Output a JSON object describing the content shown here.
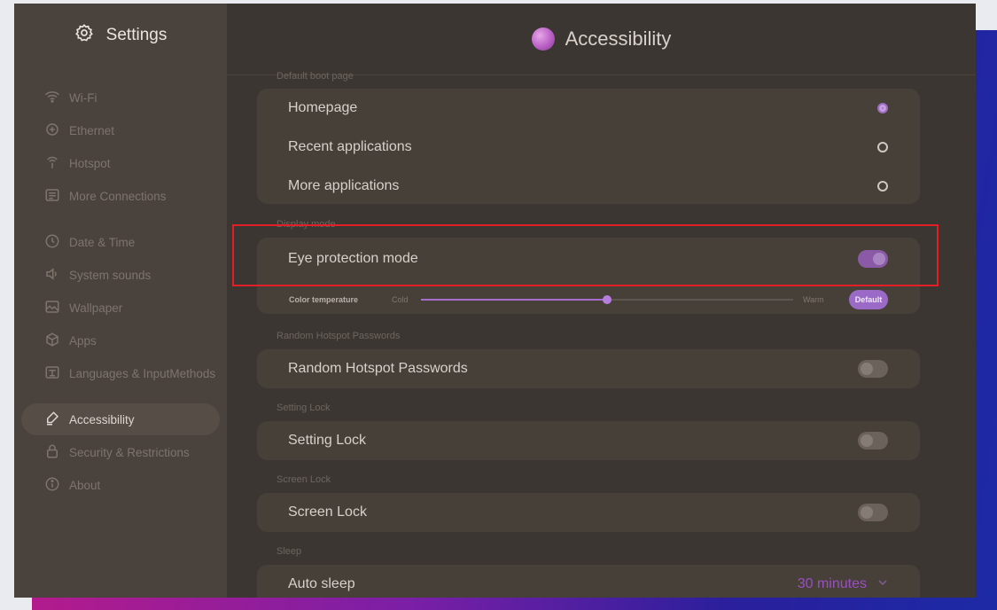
{
  "sidebar": {
    "title": "Settings",
    "items": [
      {
        "label": "Wi-Fi",
        "icon": "wifi-icon"
      },
      {
        "label": "Ethernet",
        "icon": "ethernet-icon"
      },
      {
        "label": "Hotspot",
        "icon": "hotspot-icon"
      },
      {
        "label": "More Connections",
        "icon": "connections-icon"
      },
      {
        "label": "Date & Time",
        "icon": "clock-icon"
      },
      {
        "label": "System sounds",
        "icon": "speaker-icon"
      },
      {
        "label": "Wallpaper",
        "icon": "wallpaper-icon"
      },
      {
        "label": "Apps",
        "icon": "apps-icon"
      },
      {
        "label": "Languages & InputMethods",
        "icon": "language-icon"
      },
      {
        "label": "Accessibility",
        "icon": "accessibility-icon"
      },
      {
        "label": "Security & Restrictions",
        "icon": "lock-icon"
      },
      {
        "label": "About",
        "icon": "info-icon"
      }
    ],
    "active_item": "Accessibility"
  },
  "main": {
    "title": "Accessibility",
    "sections": {
      "default_boot_page": {
        "label": "Default boot page",
        "options": [
          "Homepage",
          "Recent applications",
          "More applications"
        ],
        "selected": "Homepage"
      },
      "display_mode": {
        "label": "Display mode",
        "eye_protection_label": "Eye protection mode",
        "eye_protection_on": true,
        "color_temperature_label": "Color temperature",
        "cold_label": "Cold",
        "warm_label": "Warm",
        "color_temperature_value": 0.5,
        "default_button": "Default"
      },
      "random_hotspot": {
        "label": "Random Hotspot Passwords",
        "row_label": "Random Hotspot Passwords",
        "on": false
      },
      "setting_lock": {
        "label": "Setting Lock",
        "row_label": "Setting Lock",
        "on": false
      },
      "screen_lock": {
        "label": "Screen Lock",
        "row_label": "Screen Lock",
        "on": false
      },
      "sleep": {
        "label": "Sleep",
        "row_label": "Auto sleep",
        "value": "30 minutes"
      }
    }
  },
  "colors": {
    "accent": "#9a6ac6",
    "highlight_box": "#e21f26"
  }
}
